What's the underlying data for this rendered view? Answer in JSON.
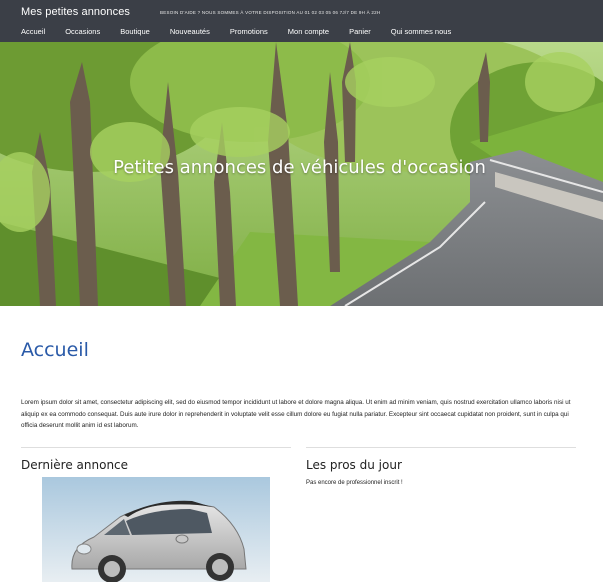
{
  "header": {
    "brand": "Mes petites annonces",
    "hotline": "Besoin d'aide ? Nous sommes à votre disposition au 01 02 03 05 06 7J/7 de 9h à 22h",
    "nav": [
      "Accueil",
      "Occasions",
      "Boutique",
      "Nouveautés",
      "Promotions",
      "Mon compte",
      "Panier",
      "Qui sommes nous"
    ]
  },
  "hero": {
    "title": "Petites annonces de véhicules d'occasion"
  },
  "main": {
    "title": "Accueil",
    "intro": "Lorem ipsum dolor sit amet, consectetur adipiscing elit, sed do eiusmod tempor incididunt ut labore et dolore magna aliqua. Ut enim ad minim veniam, quis nostrud exercitation ullamco laboris nisi ut aliquip ex ea commodo consequat. Duis aute irure dolor in reprehenderit in voluptate velit esse cillum dolore eu fugiat nulla pariatur. Excepteur sint occaecat cupidatat non proident, sunt in culpa qui officia deserunt mollit anim id est laborum."
  },
  "latest": {
    "title": "Dernière annonce"
  },
  "pros": {
    "title": "Les pros du jour",
    "empty": "Pas encore de professionnel inscrit !"
  },
  "colors": {
    "header_bg": "#3b3f47",
    "accent": "#2a5aa8"
  }
}
